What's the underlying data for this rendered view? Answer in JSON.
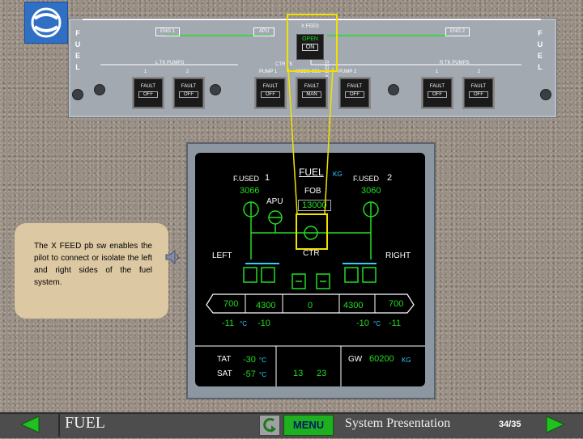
{
  "panel": {
    "side_letters": [
      "F",
      "U",
      "E",
      "L"
    ],
    "annunciators": [
      "ENG 1",
      "APU",
      "ENG 2"
    ],
    "xfeed_title": "X FEED",
    "xfeed_open": "OPEN",
    "xfeed_on": "ON",
    "labels": [
      "L TK PUMPS",
      "CTR TK",
      "R TK PUMPS",
      "PUMP 1",
      "MODE SEL",
      "PUMP 2",
      "1",
      "2",
      "1",
      "2",
      "X FEED"
    ],
    "pushbuttons": [
      {
        "upper": "FAULT",
        "lower": "OFF"
      },
      {
        "upper": "FAULT",
        "lower": "OFF"
      },
      {
        "upper": "FAULT",
        "lower": "OFF"
      },
      {
        "upper": "FAULT",
        "lower": "MAN"
      },
      {
        "upper": "FAULT",
        "lower": "OFF"
      },
      {
        "upper": "FAULT",
        "lower": "OFF"
      },
      {
        "upper": "FAULT",
        "lower": "OFF"
      }
    ]
  },
  "ecam": {
    "title": "FUEL",
    "title_unit": "KG",
    "fused1_label": "F.USED",
    "fused1_num": "1",
    "fused1_val": "3066",
    "fused2_label": "F.USED",
    "fused2_num": "2",
    "fused2_val": "3060",
    "fob_label": "FOB",
    "fob_val": "13000",
    "apu": "APU",
    "left": "LEFT",
    "ctr": "CTR",
    "right": "RIGHT",
    "tank_vals": [
      "700",
      "4300",
      "0",
      "4300",
      "700"
    ],
    "left_temp": "-11",
    "left_temp2": "-10",
    "right_temp": "-10",
    "right_temp2": "-11",
    "temp_unit": "°C",
    "tat_label": "TAT",
    "tat_val": "-30",
    "sat_label": "SAT",
    "sat_val": "-57",
    "deg_c": "°C",
    "time_h": "13",
    "time_m": "23",
    "gw_label": "GW",
    "gw_val": "60200",
    "gw_unit": "KG"
  },
  "note": {
    "text": "The X FEED pb sw enables the pilot to connect or isolate the left and right sides of the fuel system."
  },
  "bar": {
    "section": "FUEL",
    "menu": "MENU",
    "title": "System Presentation",
    "page": "34/35"
  },
  "colors": {
    "ecam_green": "#22dd22",
    "ecam_cyan": "#33ccff",
    "highlight": "#f2e200",
    "menu_green": "#1fb01f"
  }
}
